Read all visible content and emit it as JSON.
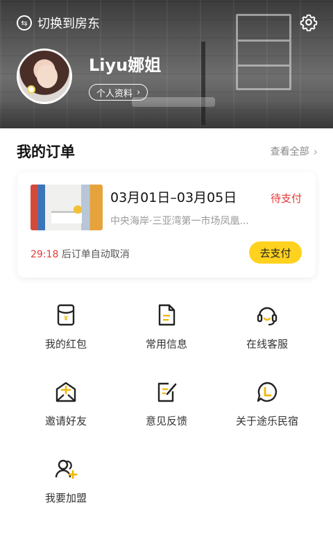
{
  "header": {
    "switch_label": "切换到房东",
    "username": "Liyu娜姐",
    "profile_label": "个人资料"
  },
  "orders": {
    "title": "我的订单",
    "view_all": "查看全部",
    "card": {
      "dates": "03月01日–03月05日",
      "status": "待支付",
      "address": "中央海岸·三亚湾第一市场凤凰...",
      "countdown": "29:18",
      "countdown_suffix": " 后订单自动取消",
      "pay_label": "去支付"
    }
  },
  "menu": {
    "items": [
      {
        "label": "我的红包",
        "icon": "red-packet-icon"
      },
      {
        "label": "常用信息",
        "icon": "document-icon"
      },
      {
        "label": "在线客服",
        "icon": "headset-icon"
      },
      {
        "label": "邀请好友",
        "icon": "invite-envelope-icon"
      },
      {
        "label": "意见反馈",
        "icon": "feedback-edit-icon"
      },
      {
        "label": "关于途乐民宿",
        "icon": "about-chat-icon"
      },
      {
        "label": "我要加盟",
        "icon": "join-user-icon"
      }
    ]
  },
  "colors": {
    "accent": "#ffd21f",
    "danger": "#e53935",
    "icon_stroke": "#222222"
  }
}
